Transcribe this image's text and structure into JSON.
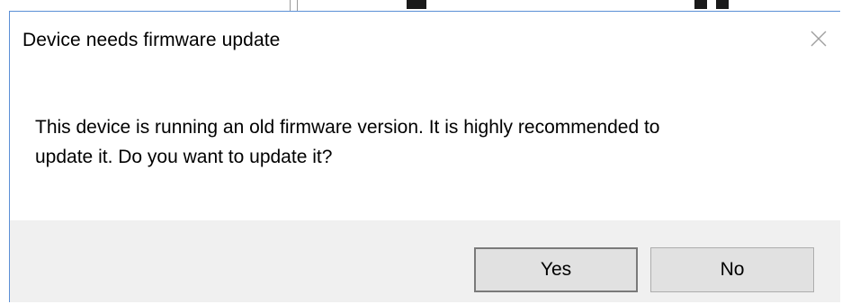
{
  "dialog": {
    "title": "Device needs firmware update",
    "message_line1": "This device is running an old firmware version. It is highly recommended to",
    "message_line2": "update it. Do you want to update it?",
    "close_icon": "close-icon",
    "buttons": {
      "yes_label": "Yes",
      "no_label": "No"
    }
  },
  "colors": {
    "window_border": "#5b8fd6",
    "footer_background": "#f0f0f0",
    "button_face": "#e1e1e1"
  }
}
